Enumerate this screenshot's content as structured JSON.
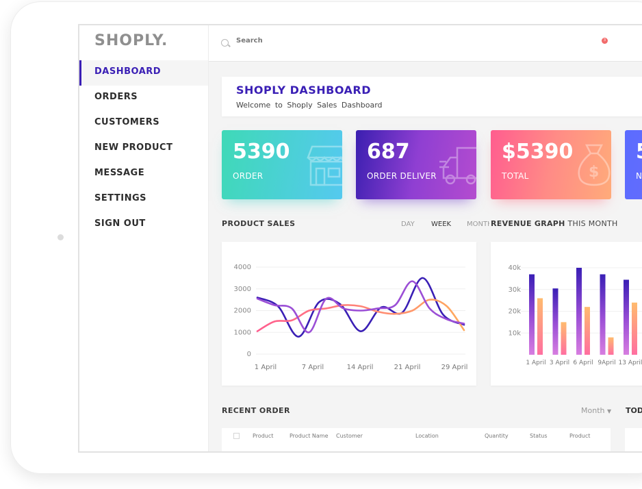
{
  "app": {
    "logo": "SHOPLY."
  },
  "sidebar": {
    "items": [
      {
        "label": "DASHBOARD",
        "active": true
      },
      {
        "label": "ORDERS"
      },
      {
        "label": "CUSTOMERS"
      },
      {
        "label": "NEW PRODUCT"
      },
      {
        "label": "MESSAGE"
      },
      {
        "label": "SETTINGS"
      },
      {
        "label": "SIGN OUT"
      }
    ]
  },
  "topbar": {
    "search_placeholder": "Search",
    "notification_count": "3"
  },
  "header": {
    "title": "SHOPLY DASHBOARD",
    "subtitle": "Welcome to Shoply Sales Dashboard"
  },
  "stats": [
    {
      "value": "5390",
      "label": "ORDER",
      "icon": "store-icon"
    },
    {
      "value": "687",
      "label": "ORDER DELIVER",
      "icon": "truck-icon"
    },
    {
      "value": "$5390",
      "label": "TOTAL",
      "icon": "money-bag-icon"
    },
    {
      "value": "5",
      "label": "N",
      "icon": ""
    }
  ],
  "product_sales": {
    "title": "PRODUCT SALES",
    "tabs": [
      "DAY",
      "WEEK",
      "MONTH"
    ],
    "active_tab": "WEEK"
  },
  "revenue": {
    "title_bold": "REVENUE GRAPH",
    "title_rest": " THIS MONTH"
  },
  "recent": {
    "title": "RECENT ORDER",
    "filter": "Month",
    "today": "TOD",
    "columns": [
      "Product",
      "Product Name",
      "Customer",
      "Location",
      "Quantity",
      "Status",
      "Product"
    ]
  },
  "colors": {
    "primary": "#3a1fb5",
    "pink": "#ff5d8f",
    "orange": "#ffab5e",
    "purple": "#9b4fd6"
  },
  "chart_data": [
    {
      "type": "line",
      "x": [
        "1 April",
        "7 April",
        "14 April",
        "21 April",
        "29 April"
      ],
      "ylim": [
        0,
        4000
      ],
      "yticks": [
        0,
        1000,
        2000,
        3000,
        4000
      ],
      "series": [
        {
          "values": [
            2600,
            2200,
            800,
            2400,
            2300,
            1050,
            2150,
            1900,
            3500,
            1800,
            1350
          ]
        },
        {
          "values": [
            1050,
            1500,
            1550,
            2000,
            2100,
            2250,
            2200,
            1950,
            1850,
            2000,
            2500,
            2200,
            1100
          ]
        },
        {
          "values": [
            2550,
            2250,
            2100,
            1000,
            2550,
            2100,
            2000,
            2100,
            2250,
            3350,
            2100,
            1600,
            1400
          ]
        }
      ]
    },
    {
      "type": "bar",
      "categories": [
        "1 April",
        "3 April",
        "6 April",
        "9April",
        "13 April"
      ],
      "ylim": [
        0,
        40000
      ],
      "yticks": [
        "10k",
        "20k",
        "30k",
        "40k"
      ],
      "series": [
        {
          "values": [
            37000,
            30500,
            40000,
            37000,
            34500
          ]
        },
        {
          "values": [
            26000,
            15000,
            22000,
            8000,
            24000
          ]
        }
      ]
    }
  ]
}
